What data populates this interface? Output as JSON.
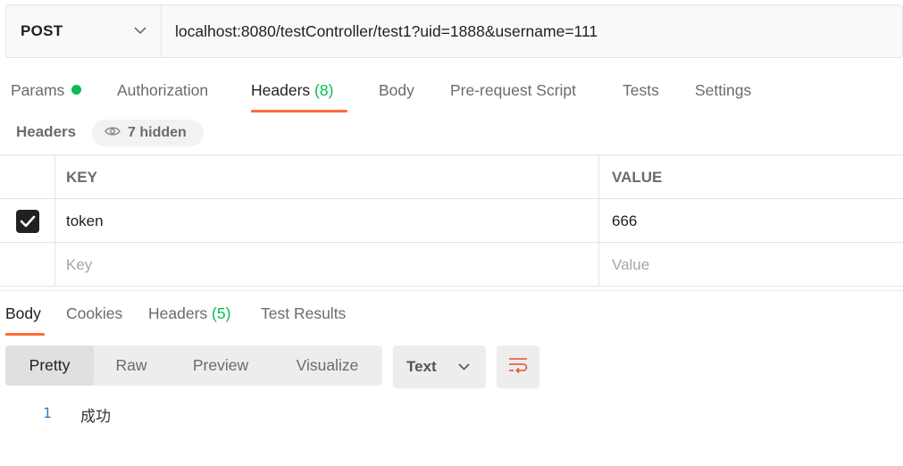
{
  "request": {
    "method": "POST",
    "url": "localhost:8080/testController/test1?uid=1888&username=111"
  },
  "request_tabs": [
    {
      "label": "Params",
      "count": null,
      "indicator_color": "#0cbb52"
    },
    {
      "label": "Authorization"
    },
    {
      "label": "Headers",
      "count": "(8)",
      "active": true
    },
    {
      "label": "Body"
    },
    {
      "label": "Pre-request Script"
    },
    {
      "label": "Tests"
    },
    {
      "label": "Settings"
    }
  ],
  "headers_section": {
    "title": "Headers",
    "hidden_label": "7 hidden",
    "hidden_icon": "eye-icon"
  },
  "headers_table": {
    "columns": [
      "KEY",
      "VALUE"
    ],
    "rows": [
      {
        "checked": true,
        "key": "token",
        "value": "666"
      }
    ],
    "placeholder": {
      "key": "Key",
      "value": "Value"
    }
  },
  "response_tabs": [
    {
      "label": "Body",
      "active": true
    },
    {
      "label": "Cookies"
    },
    {
      "label": "Headers",
      "count": "(5)"
    },
    {
      "label": "Test Results"
    }
  ],
  "body_toolbar": {
    "view_modes": [
      "Pretty",
      "Raw",
      "Preview",
      "Visualize"
    ],
    "selected_mode": "Pretty",
    "format": "Text",
    "wrap_icon": "wrap-lines-icon"
  },
  "response_body": {
    "lines": [
      {
        "number": "1",
        "text": "成功"
      }
    ]
  },
  "colors": {
    "accent": "#ff6c37",
    "success": "#0cbb52",
    "line_number": "#2b7fc4"
  }
}
